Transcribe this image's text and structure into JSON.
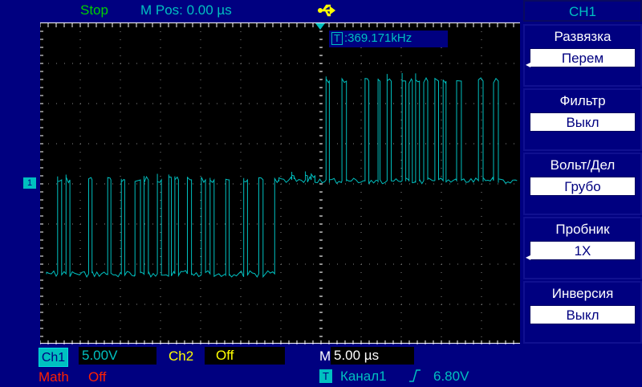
{
  "header": {
    "status": "Stop",
    "mpos": "M Pos: 0.00 µs",
    "usb_icon": "usb-icon"
  },
  "trigger_freq": {
    "icon": "T",
    "value": ":369.171kHz"
  },
  "side_menu": {
    "channel": "CH1",
    "items": [
      {
        "label": "Развязка",
        "value": "Перем"
      },
      {
        "label": "Фильтр",
        "value": "Выкл"
      },
      {
        "label": "Вольт/Дел",
        "value": "Грубо"
      },
      {
        "label": "Пробник",
        "value": "1X"
      },
      {
        "label": "Инверсия",
        "value": "Выкл"
      }
    ]
  },
  "bottom": {
    "ch1_label": "Ch1",
    "ch1_scale": "5.00V",
    "ch2_label": "Ch2",
    "ch2_scale": "Off",
    "time_label": "M",
    "time_scale": "5.00 µs",
    "math_label": "Math",
    "math_value": "Off",
    "trig_icon": "T",
    "trig_source": "Канал1",
    "trig_slope": "⎍",
    "trig_level": "6.80V"
  },
  "channel_marker": "1",
  "colors": {
    "ch1": "#00c0c0",
    "background": "#000080",
    "ch2": "#ffff00",
    "math": "#ff2000"
  }
}
